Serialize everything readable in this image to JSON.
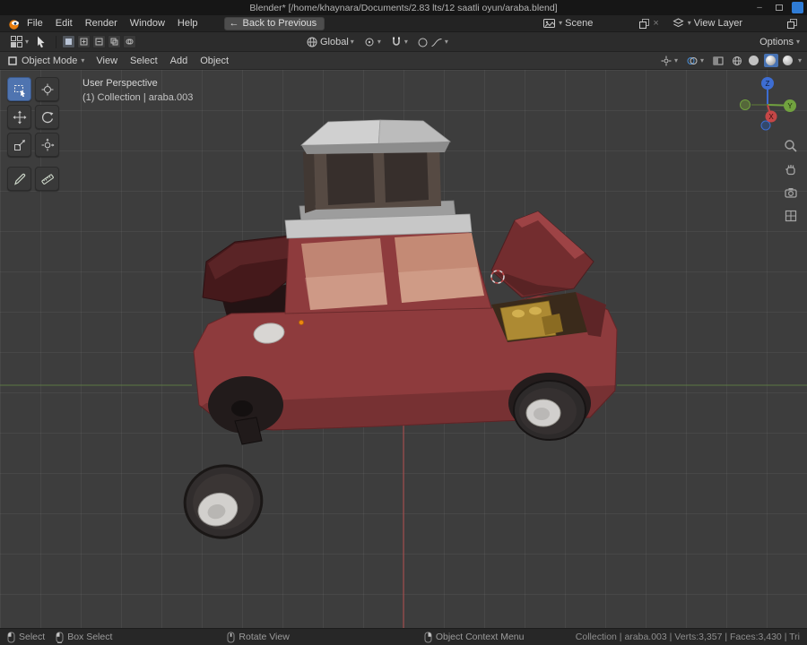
{
  "window": {
    "title": "Blender* [/home/khaynara/Documents/2.83 lts/12 saatli oyun/araba.blend]"
  },
  "icons": {
    "chevron_down": "▾",
    "minimize": "–",
    "back_arrow": "←",
    "unlink_x": "×"
  },
  "menubar": {
    "menus": [
      "File",
      "Edit",
      "Render",
      "Window",
      "Help"
    ],
    "back_button": "Back to Previous",
    "scene": {
      "label": "Scene"
    },
    "view_layer": {
      "label": "View Layer"
    }
  },
  "tool_header": {
    "orientation": "Global",
    "options": "Options"
  },
  "viewport_header": {
    "mode": "Object Mode",
    "menus": [
      "View",
      "Select",
      "Add",
      "Object"
    ]
  },
  "viewport": {
    "perspective": "User Perspective",
    "collection": "(1) Collection | araba.003",
    "gizmo_axes": {
      "x": "X",
      "y": "Y",
      "z": "Z"
    }
  },
  "status_bar": {
    "hints": [
      "Select",
      "Box Select",
      "Rotate View",
      "Object Context Menu"
    ],
    "info": "Collection | araba.003 | Verts:3,357 | Faces:3,430 | Tri"
  },
  "colors": {
    "accent": "#4772b3",
    "axis_x": "#aa4c4c",
    "axis_y": "#5d7a45",
    "axis_z": "#3d6dd2",
    "car_body": "#8e3b3d",
    "car_window": "#c08573"
  }
}
